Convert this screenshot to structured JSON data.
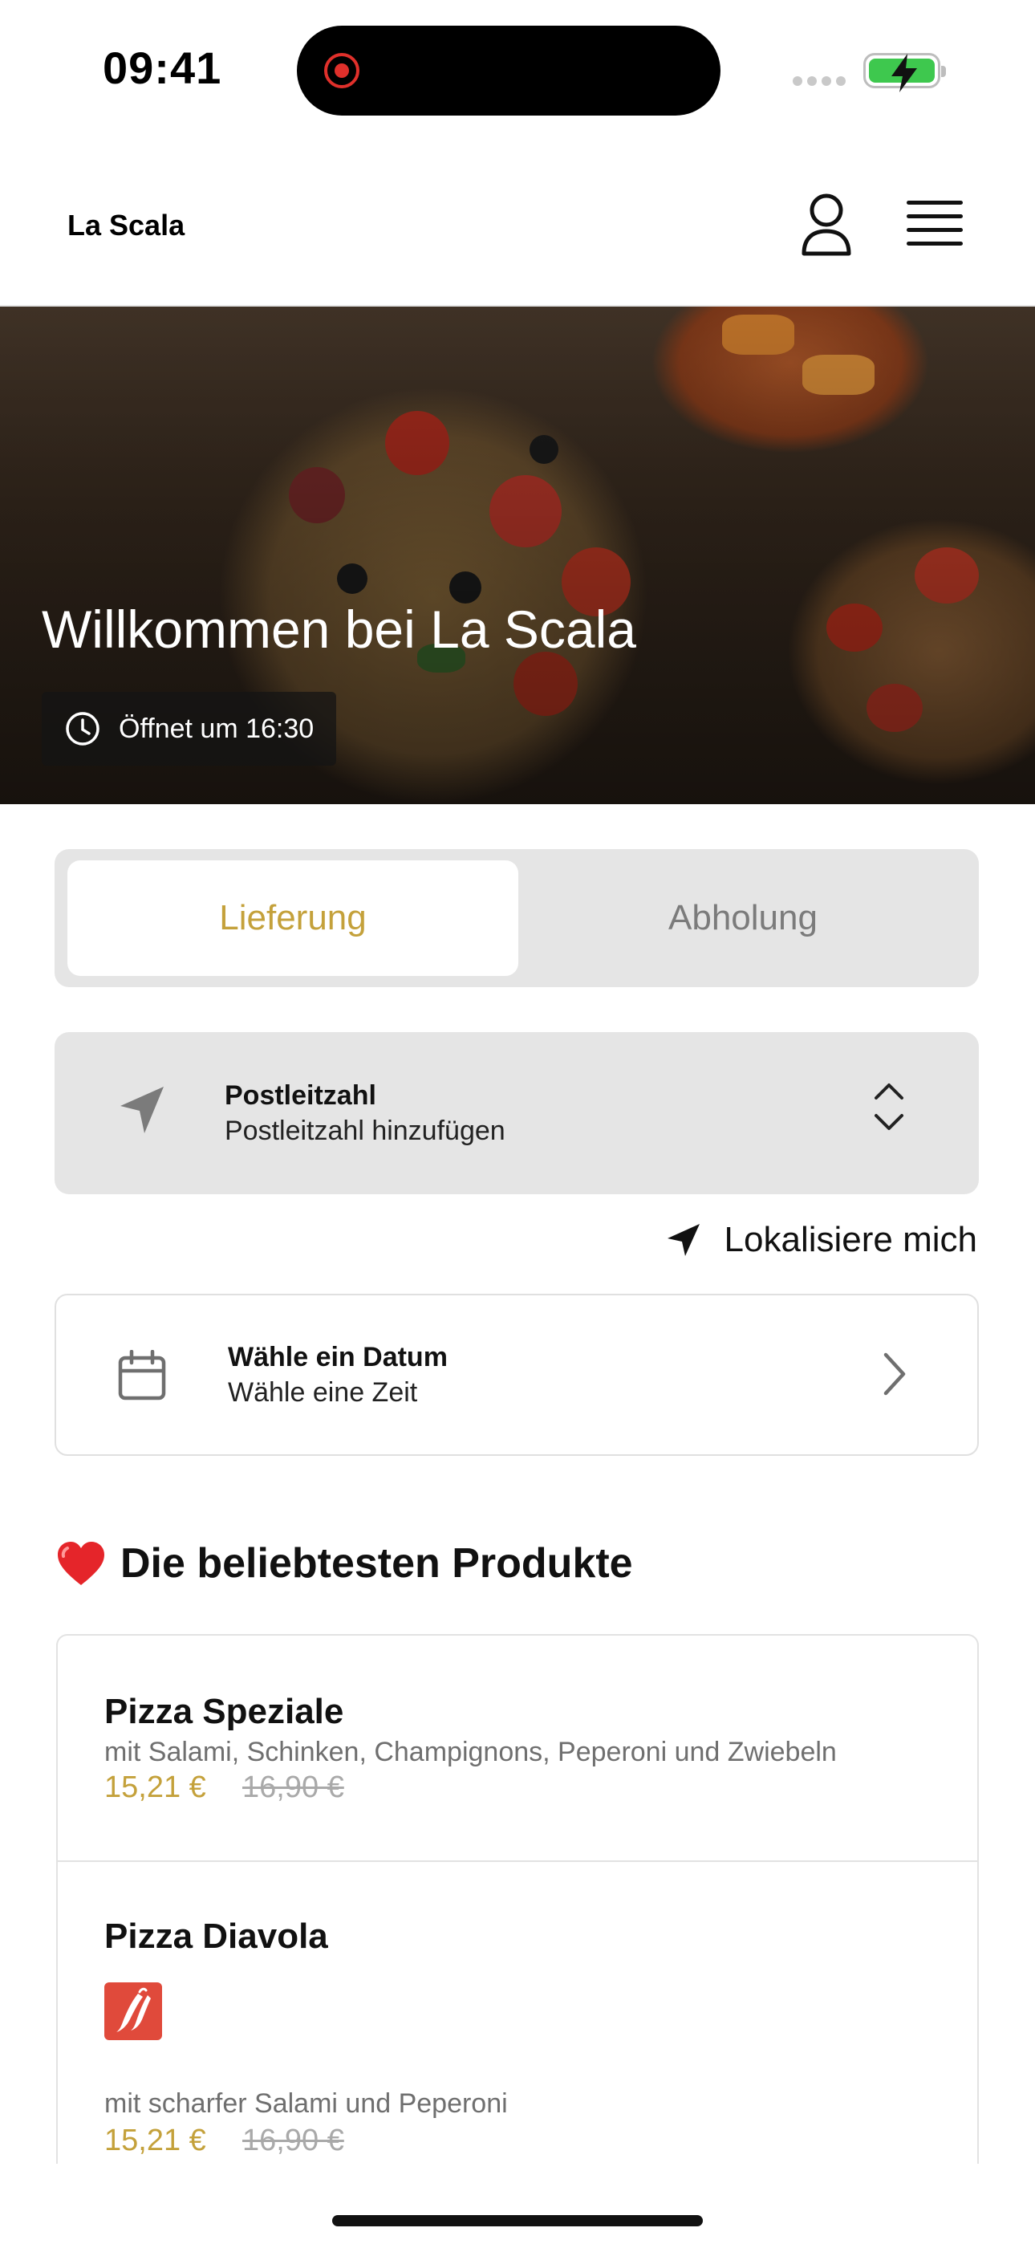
{
  "status_bar": {
    "time": "09:41"
  },
  "header": {
    "brand": "La Scala"
  },
  "hero": {
    "title": "Willkommen bei La Scala",
    "hours": "Öffnet um 16:30"
  },
  "order_type": {
    "options": [
      "Lieferung",
      "Abholung"
    ],
    "selected": "Lieferung"
  },
  "postal_code": {
    "label": "Postleitzahl",
    "value": "Postleitzahl hinzufügen"
  },
  "locate": {
    "label": "Lokalisiere mich"
  },
  "date_picker": {
    "label": "Wähle ein Datum",
    "value": "Wähle eine Zeit"
  },
  "popular": {
    "emoji": "❤️",
    "title": "Die beliebtesten Produkte",
    "products": [
      {
        "name": "Pizza Speziale",
        "description": "mit Salami, Schinken, Champignons, Peperoni und Zwiebeln",
        "price": "15,21 €",
        "old_price": "16,90 €"
      },
      {
        "name": "Pizza Diavola",
        "description": "mit scharfer Salami und Peperoni",
        "price": "15,21 €",
        "old_price": "16,90 €",
        "badge_icon": "chili-icon"
      }
    ]
  },
  "colors": {
    "accent": "#c4a13b",
    "spicy_badge": "#e04a3b",
    "control_bg": "#e5e5e5"
  }
}
